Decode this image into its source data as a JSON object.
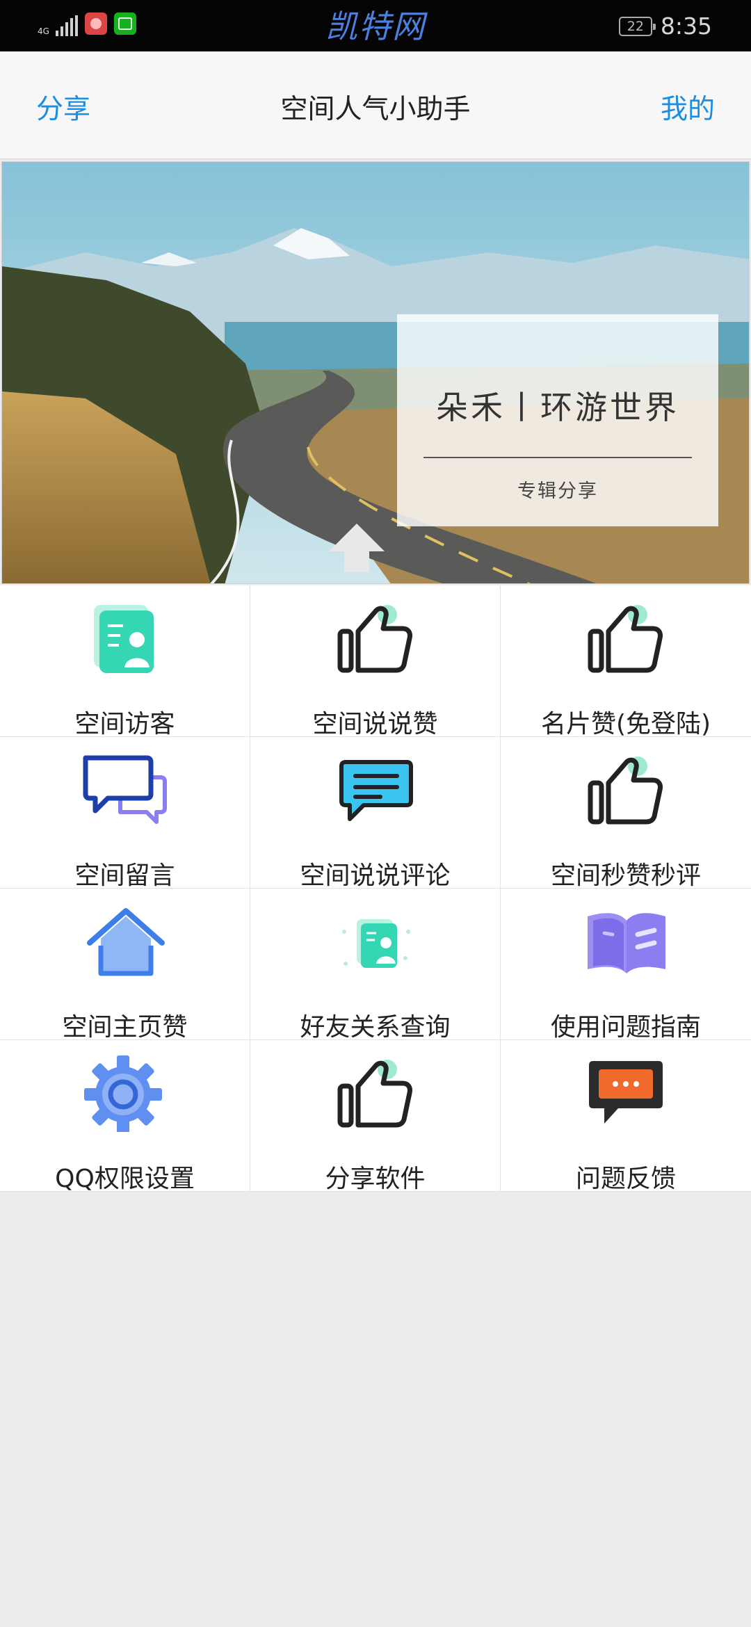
{
  "status_bar": {
    "network": "4G",
    "watermark": "凯特网",
    "battery": "22",
    "time": "8:35"
  },
  "header": {
    "left_link": "分享",
    "title": "空间人气小助手",
    "right_link": "我的"
  },
  "banner": {
    "card_title": "朵禾丨环游世界",
    "card_subtitle": "专辑分享"
  },
  "menu": {
    "items": [
      {
        "label": "空间访客",
        "icon": "visitor-card-icon"
      },
      {
        "label": "空间说说赞",
        "icon": "thumbs-up-icon"
      },
      {
        "label": "名片赞(免登陆)",
        "icon": "thumbs-up-icon"
      },
      {
        "label": "空间留言",
        "icon": "chat-bubbles-icon"
      },
      {
        "label": "空间说说评论",
        "icon": "comment-icon"
      },
      {
        "label": "空间秒赞秒评",
        "icon": "thumbs-up-icon"
      },
      {
        "label": "空间主页赞",
        "icon": "home-icon"
      },
      {
        "label": "好友关系查询",
        "icon": "friend-card-icon"
      },
      {
        "label": "使用问题指南",
        "icon": "book-icon"
      },
      {
        "label": "QQ权限设置",
        "icon": "gear-icon"
      },
      {
        "label": "分享软件",
        "icon": "thumbs-up-icon"
      },
      {
        "label": "问题反馈",
        "icon": "feedback-icon"
      }
    ]
  },
  "colors": {
    "link": "#1d8ddf",
    "accent_teal": "#35d6b3",
    "icon_blue": "#4f86ee",
    "icon_purple": "#8a7ef0",
    "feedback_orange": "#ef6a2b"
  }
}
